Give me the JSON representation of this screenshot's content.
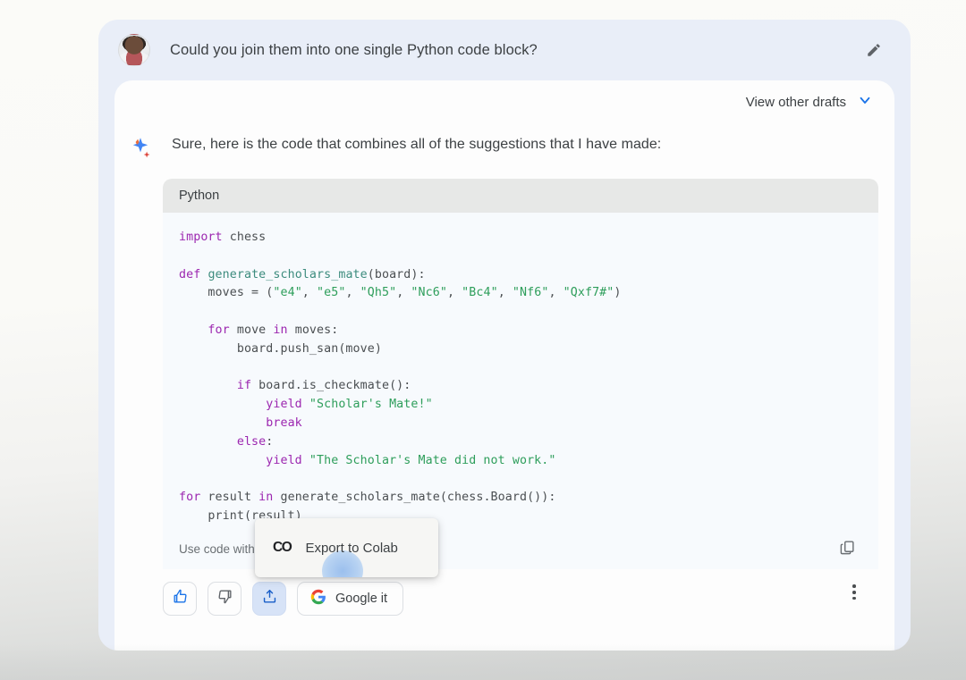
{
  "user_message": {
    "avatar_name": "user-avatar",
    "text": "Could you join them into one single Python code block?",
    "edit_icon": "pencil-icon"
  },
  "response": {
    "drafts_label": "View other drafts",
    "drafts_chevron_icon": "chevron-down-icon",
    "assistant_icon": "bard-sparkle-icon",
    "text": "Sure, here is the code that combines all of the suggestions that I have made:"
  },
  "code_block": {
    "language_label": "Python",
    "caution_label": "Use code with",
    "copy_icon": "copy-icon",
    "lines": [
      [
        {
          "t": "import",
          "c": "kw"
        },
        {
          "t": " chess",
          "c": "pln"
        }
      ],
      [],
      [
        {
          "t": "def",
          "c": "kw"
        },
        {
          "t": " ",
          "c": "pln"
        },
        {
          "t": "generate_scholars_mate",
          "c": "fn"
        },
        {
          "t": "(board):",
          "c": "pln"
        }
      ],
      [
        {
          "t": "    moves = (",
          "c": "pln"
        },
        {
          "t": "\"e4\"",
          "c": "str"
        },
        {
          "t": ", ",
          "c": "pln"
        },
        {
          "t": "\"e5\"",
          "c": "str"
        },
        {
          "t": ", ",
          "c": "pln"
        },
        {
          "t": "\"Qh5\"",
          "c": "str"
        },
        {
          "t": ", ",
          "c": "pln"
        },
        {
          "t": "\"Nc6\"",
          "c": "str"
        },
        {
          "t": ", ",
          "c": "pln"
        },
        {
          "t": "\"Bc4\"",
          "c": "str"
        },
        {
          "t": ", ",
          "c": "pln"
        },
        {
          "t": "\"Nf6\"",
          "c": "str"
        },
        {
          "t": ", ",
          "c": "pln"
        },
        {
          "t": "\"Qxf7#\"",
          "c": "str"
        },
        {
          "t": ")",
          "c": "pln"
        }
      ],
      [],
      [
        {
          "t": "    ",
          "c": "pln"
        },
        {
          "t": "for",
          "c": "kw"
        },
        {
          "t": " move ",
          "c": "pln"
        },
        {
          "t": "in",
          "c": "kw"
        },
        {
          "t": " moves:",
          "c": "pln"
        }
      ],
      [
        {
          "t": "        board.push_san(move)",
          "c": "pln"
        }
      ],
      [],
      [
        {
          "t": "        ",
          "c": "pln"
        },
        {
          "t": "if",
          "c": "kw"
        },
        {
          "t": " board.is_checkmate():",
          "c": "pln"
        }
      ],
      [
        {
          "t": "            ",
          "c": "pln"
        },
        {
          "t": "yield",
          "c": "kw"
        },
        {
          "t": " ",
          "c": "pln"
        },
        {
          "t": "\"Scholar's Mate!\"",
          "c": "str"
        }
      ],
      [
        {
          "t": "            ",
          "c": "pln"
        },
        {
          "t": "break",
          "c": "kw"
        }
      ],
      [
        {
          "t": "        ",
          "c": "pln"
        },
        {
          "t": "else",
          "c": "kw"
        },
        {
          "t": ":",
          "c": "pln"
        }
      ],
      [
        {
          "t": "            ",
          "c": "pln"
        },
        {
          "t": "yield",
          "c": "kw"
        },
        {
          "t": " ",
          "c": "pln"
        },
        {
          "t": "\"The Scholar's Mate did not work.\"",
          "c": "str"
        }
      ],
      [],
      [
        {
          "t": "for",
          "c": "kw"
        },
        {
          "t": " result ",
          "c": "pln"
        },
        {
          "t": "in",
          "c": "kw"
        },
        {
          "t": " generate_scholars_mate(chess.Board()):",
          "c": "pln"
        }
      ],
      [
        {
          "t": "    print(result)",
          "c": "pln"
        }
      ]
    ]
  },
  "actions": {
    "thumbs_up_icon": "thumbs-up-icon",
    "thumbs_down_icon": "thumbs-down-icon",
    "share_icon": "share-upload-icon",
    "google_it_label": "Google it",
    "google_logo_icon": "google-g-icon",
    "more_options_icon": "more-vertical-icon"
  },
  "export_menu": {
    "colab_icon_text": "CO",
    "label": "Export to Colab"
  },
  "colors": {
    "accent_blue": "#1a73e8",
    "keyword_purple": "#9c27b0",
    "string_green": "#2e9e5b",
    "function_teal": "#3d8c7e",
    "card_bg": "#e9eef8",
    "code_header_bg": "#e7e8e7",
    "code_body_bg": "#f7fafd"
  }
}
